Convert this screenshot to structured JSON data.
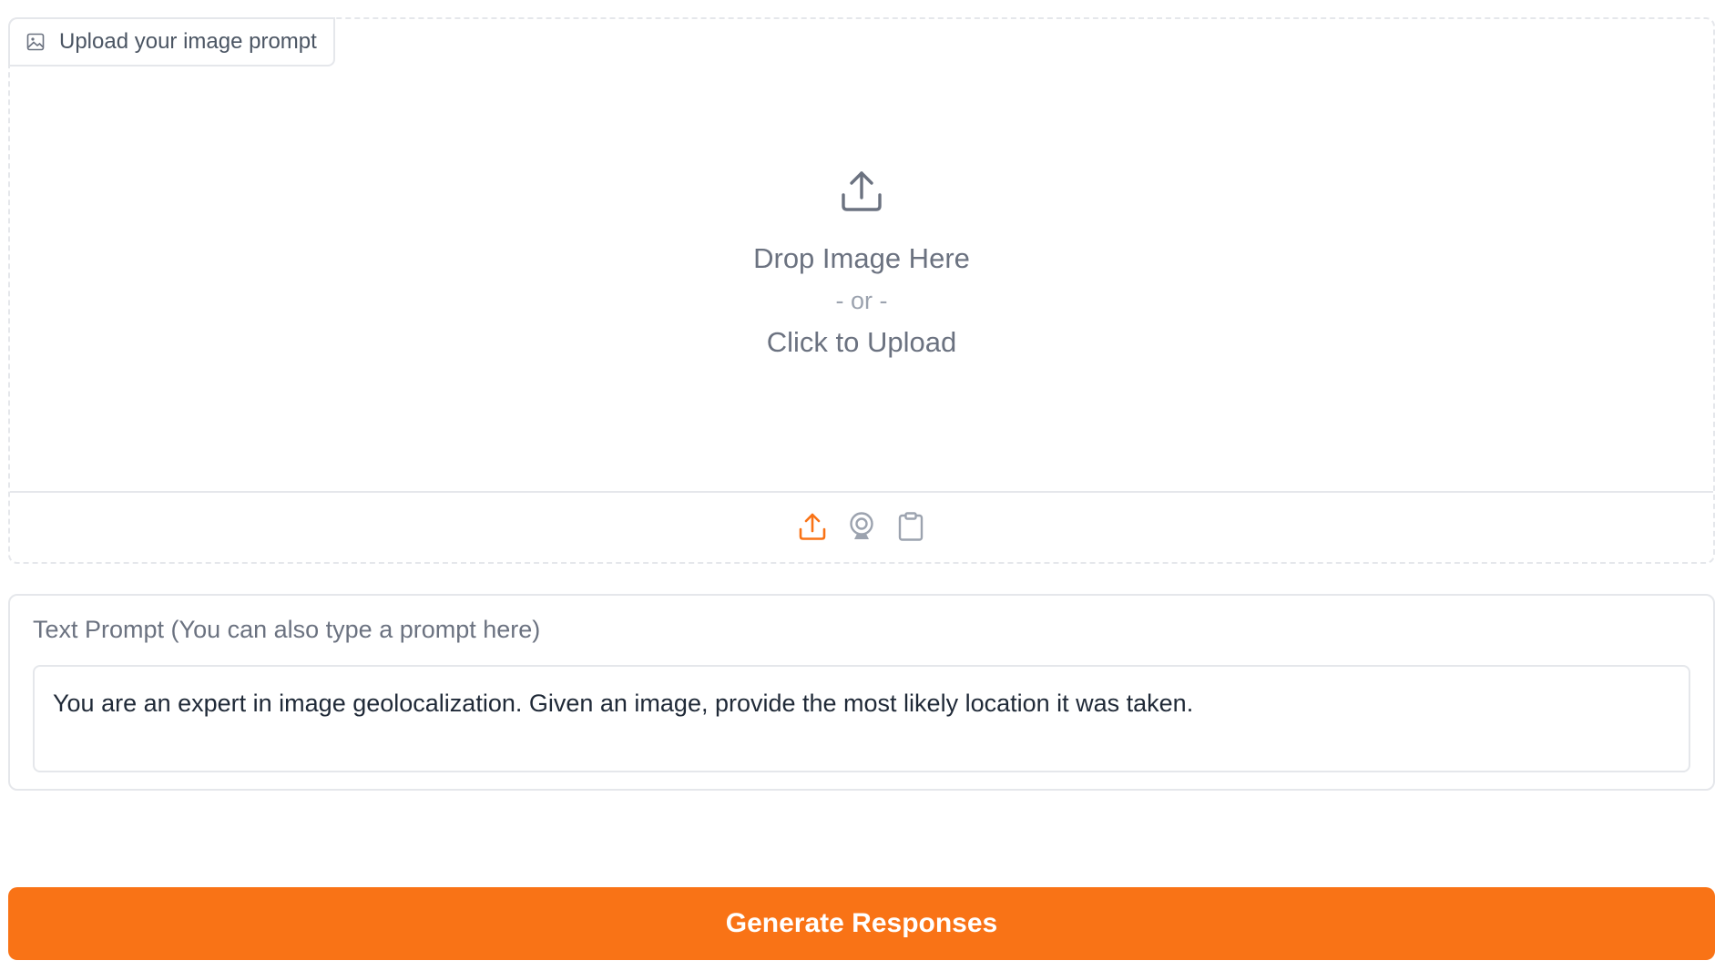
{
  "image_upload": {
    "label": "Upload your image prompt",
    "drop_text": "Drop Image Here",
    "or_text": "- or -",
    "click_text": "Click to Upload",
    "sources": [
      {
        "name": "upload",
        "icon": "upload-icon",
        "active": true
      },
      {
        "name": "webcam",
        "icon": "webcam-icon",
        "active": false
      },
      {
        "name": "clipboard",
        "icon": "clipboard-icon",
        "active": false
      }
    ]
  },
  "text_prompt": {
    "label": "Text Prompt (You can also type a prompt here)",
    "value": "You are an expert in image geolocalization. Given an image, provide the most likely location it was taken."
  },
  "generate_button": {
    "label": "Generate Responses"
  },
  "colors": {
    "accent": "#f97316",
    "border": "#e5e7eb",
    "muted_text": "#6b7280"
  }
}
